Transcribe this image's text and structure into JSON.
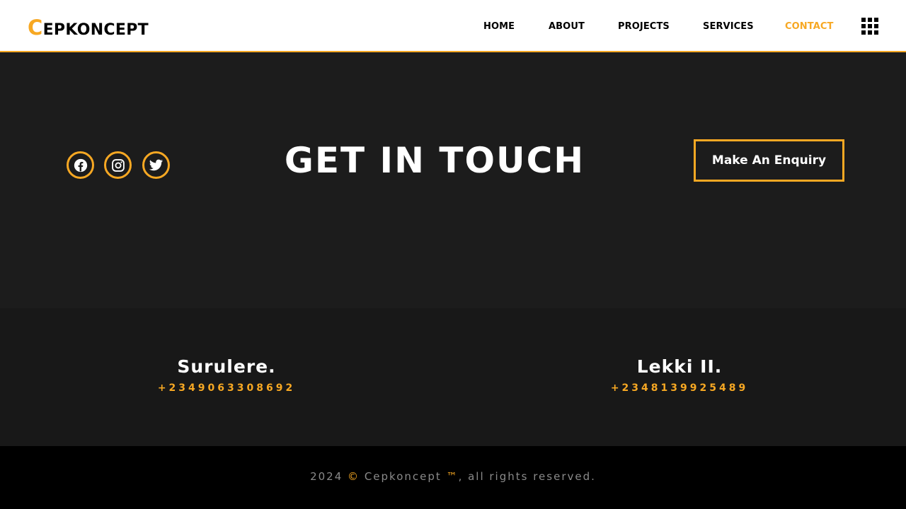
{
  "brand": {
    "initial": "C",
    "rest": "EPKONCEPT",
    "accent_color": "#f7a823",
    "dark_color": "#1c1c1c"
  },
  "nav": {
    "items": [
      {
        "label": "HOME",
        "active": false
      },
      {
        "label": "ABOUT",
        "active": false
      },
      {
        "label": "PROJECTS",
        "active": false
      },
      {
        "label": "SERVICES",
        "active": false
      },
      {
        "label": "CONTACT",
        "active": true
      }
    ],
    "menu_icon": "grid-menu-icon"
  },
  "hero": {
    "title": "GET IN TOUCH",
    "enquiry_label": "Make An Enquiry",
    "social": [
      {
        "name": "facebook",
        "icon": "facebook-icon"
      },
      {
        "name": "instagram",
        "icon": "instagram-icon"
      },
      {
        "name": "twitter",
        "icon": "twitter-icon"
      }
    ]
  },
  "locations": [
    {
      "name": "Surulere.",
      "phone": "+2349063308692"
    },
    {
      "name": "Lekki II.",
      "phone": "+2348139925489"
    }
  ],
  "footer": {
    "year": "2024",
    "symbol": "©",
    "brand": "Cepkoncept",
    "tm": "™",
    "suffix": ", all rights reserved."
  }
}
